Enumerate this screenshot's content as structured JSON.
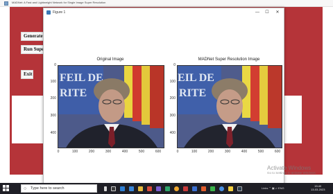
{
  "app_window": {
    "title": "MADNet: A Fast and Lightweight Network for Single Image Super Resolution",
    "buttons": {
      "generate": "Generate A",
      "run": "Run Super",
      "exit": "Exit"
    }
  },
  "figure_window": {
    "title": "Figure 1",
    "controls": {
      "minimize": "—",
      "maximize": "☐",
      "close": "✕"
    },
    "left_plot": {
      "title": "Original Image",
      "y_ticks": [
        "0",
        "100",
        "200",
        "300",
        "400"
      ],
      "x_ticks": [
        "0",
        "100",
        "200",
        "300",
        "400",
        "500",
        "600"
      ],
      "background_text": "FEIL DE\nRITE"
    },
    "right_plot": {
      "title": "MADNet Super Resolution Image",
      "y_ticks": [
        "0",
        "100",
        "200",
        "300",
        "400"
      ],
      "x_ticks": [
        "0",
        "100",
        "200",
        "300",
        "400",
        "500",
        "600"
      ],
      "background_text": "EIL DE\nRITE"
    }
  },
  "taskbar": {
    "search_placeholder": "Type here to search",
    "tray_text": "Links  ⌃ ▣ ♫ ENG",
    "time": "15:40",
    "date": "13-03-2023"
  },
  "watermark": {
    "title": "Activate Windows",
    "subtitle": "Go to Settings to activate Windows."
  },
  "colors": {
    "app_background": "#b53439",
    "taskbar": "#1f1f26",
    "window_bg": "#ffffff"
  }
}
